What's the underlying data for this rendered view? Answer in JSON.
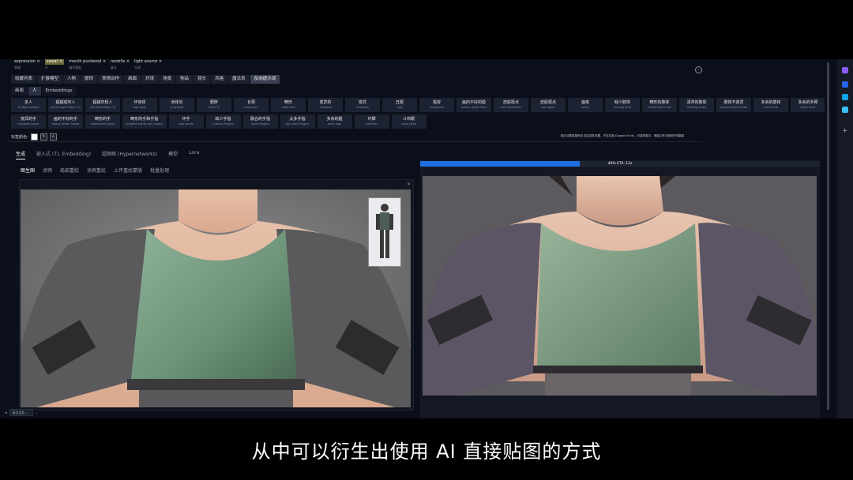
{
  "prompt_tags": [
    {
      "en": "expression",
      "cn": "表情",
      "highlight": false
    },
    {
      "en": "sweat",
      "cn": "汗",
      "highlight": true
    },
    {
      "en": "mouth puckered",
      "cn": "嘴巴撅起",
      "highlight": false
    },
    {
      "en": "nostrils",
      "cn": "鼻孔",
      "highlight": false
    },
    {
      "en": "light source",
      "cn": "光源",
      "highlight": false
    }
  ],
  "category_tabs": [
    "收藏列表",
    "扩展模型",
    "人物",
    "服饰",
    "表情动作",
    "画面",
    "环境",
    "场景",
    "物品",
    "镜头",
    "风格",
    "魔法系",
    "反向提示词"
  ],
  "active_category": "反向提示词",
  "sub_tabs": [
    "画面",
    "人",
    "Embeddings"
  ],
  "active_sub_tab": "人",
  "tag_rows": [
    [
      {
        "cn": "多人",
        "en": "Multiple people"
      },
      {
        "cn": "超越成年人",
        "en": "(AS-YoungV2 Neg:1.3)"
      },
      {
        "cn": "超越年轻人",
        "en": "(AS-Adult Neg:1.3)"
      },
      {
        "cn": "坏身体",
        "en": "bad body"
      },
      {
        "cn": "身体长",
        "en": "long body"
      },
      {
        "cn": "肥胖",
        "en": "(fat:1.2)"
      },
      {
        "cn": "长颈",
        "en": "long neck"
      },
      {
        "cn": "畸形",
        "en": "deformed"
      },
      {
        "cn": "变异的",
        "en": "mutated"
      },
      {
        "cn": "变异",
        "en": "mutation"
      },
      {
        "cn": "丑陋",
        "en": "ugly"
      },
      {
        "cn": "毁容",
        "en": "disfigured"
      },
      {
        "cn": "画的不好的脸",
        "en": "poorly drawn face"
      },
      {
        "cn": "皮肤斑点",
        "en": "skin blemishes"
      },
      {
        "cn": "皮肤斑点",
        "en": "skin spots"
      },
      {
        "cn": "痤疮",
        "en": "acnes"
      },
      {
        "cn": "缺少肢体",
        "en": "missing limb"
      },
      {
        "cn": "畸形的肢体",
        "en": "malformed limbs"
      },
      {
        "cn": "漂浮的肢体",
        "en": "floating limbs"
      },
      {
        "cn": "肢体不连贯",
        "en": "disconnected limbs"
      },
      {
        "cn": "多余的肢体",
        "en": "extra limb"
      },
      {
        "cn": "多余的手臂",
        "en": "extra arms"
      }
    ],
    [
      {
        "cn": "变异的手",
        "en": "mutated hands"
      },
      {
        "cn": "画的不好的手",
        "en": "poorly drawn hands"
      },
      {
        "cn": "畸形的手",
        "en": "malformed hands"
      },
      {
        "cn": "畸形的手和手指",
        "en": "mutated hands and fingers"
      },
      {
        "cn": "坏手",
        "en": "bad hands"
      },
      {
        "cn": "缺少手指",
        "en": "missing fingers"
      },
      {
        "cn": "融合的手指",
        "en": "fused fingers"
      },
      {
        "cn": "太多手指",
        "en": "too many fingers"
      },
      {
        "cn": "多余的腿",
        "en": "extra legs"
      },
      {
        "cn": "坏脚",
        "en": "bad feet"
      },
      {
        "cn": "斗鸡眼",
        "en": "cross-eyed"
      }
    ]
  ],
  "color_label": "标签颜色:",
  "note_text": "图片加载效果来自 前往插件设置，不支持本(Google Drive)，可能导致中，请能正常中使用完毕翻译",
  "main_tabs": [
    "生成",
    "嵌入式 (T.I. Embedding)",
    "超网络 (Hypernetworks)",
    "模型",
    "Lora"
  ],
  "active_main_tab": "生成",
  "img_tabs": [
    "图生图",
    "涂鸦",
    "局部重绘",
    "涂鸦重绘",
    "上传重绘蒙版",
    "批量处理"
  ],
  "active_img_tab": "图生图",
  "progress": {
    "fraction": 0.4,
    "text": "40% ETA: 12s"
  },
  "bottom_input_placeholder": "请点击此...",
  "panel_close": "×",
  "expand_icon": "⌄",
  "caption": "从中可以衍生出使用 AI 直接贴图的方式"
}
